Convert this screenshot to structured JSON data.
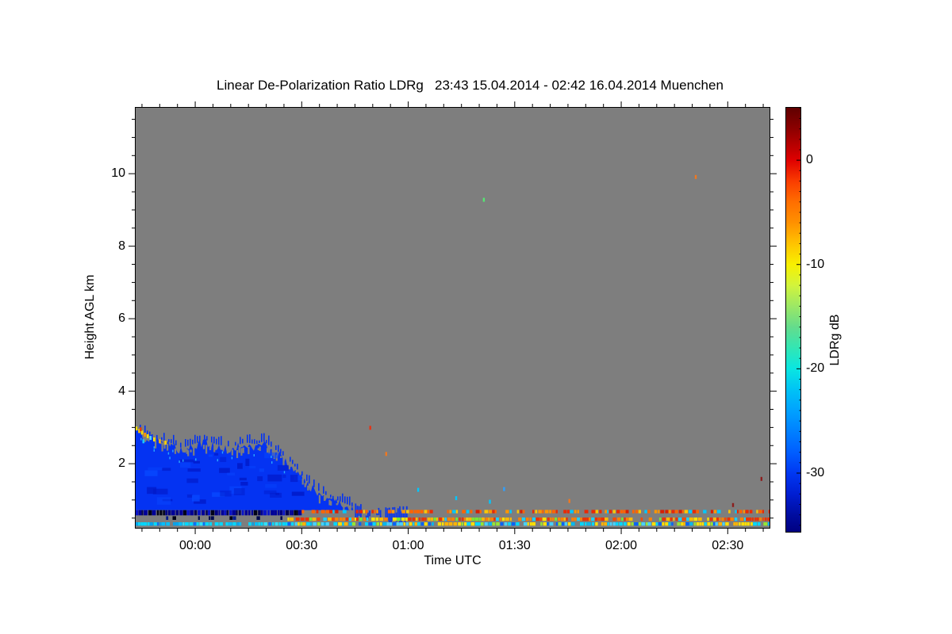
{
  "title": "Linear De-Polarization Ratio LDRg   23:43 15.04.2014 - 02:42 16.04.2014 Muenchen",
  "station": "Muenchen",
  "time_span": {
    "start": "23:43 15.04.2014",
    "end": "02:42 16.04.2014"
  },
  "axes": {
    "x": {
      "label": "Time UTC",
      "tick_labels": [
        "00:00",
        "00:30",
        "01:00",
        "01:30",
        "02:00",
        "02:30"
      ]
    },
    "y": {
      "label": "Height AGL km",
      "tick_labels": [
        "2",
        "4",
        "6",
        "8",
        "10"
      ]
    }
  },
  "colorbar": {
    "label": "LDRg dB",
    "tick_labels": [
      "0",
      "-10",
      "-20",
      "-30"
    ]
  },
  "chart_data": {
    "type": "heatmap",
    "title": "Linear De-Polarization Ratio LDRg   23:43 15.04.2014 - 02:42 16.04.2014 Muenchen",
    "xlabel": "Time UTC",
    "ylabel": "Height AGL km",
    "x_axis": {
      "start_utc": "23:43",
      "end_utc": "02:42",
      "minutes_total": 179,
      "major_ticks": [
        {
          "label": "00:00",
          "minute": 17
        },
        {
          "label": "00:30",
          "minute": 47
        },
        {
          "label": "01:00",
          "minute": 77
        },
        {
          "label": "01:30",
          "minute": 107
        },
        {
          "label": "02:00",
          "minute": 137
        },
        {
          "label": "02:30",
          "minute": 167
        }
      ],
      "minor_tick_step_minutes": 5,
      "first_minor_minute": 2
    },
    "y_axis": {
      "range_km": [
        0.21,
        11.84
      ],
      "major_ticks": [
        2,
        4,
        6,
        8,
        10
      ],
      "minor_step_km": 0.5
    },
    "background": {
      "color": "#7e7e7e",
      "meaning": "no signal / below detection"
    },
    "colorbar": {
      "label": "LDRg dB",
      "value_range": [
        -35.7,
        5.1
      ],
      "tick_values": [
        0,
        -10,
        -20,
        -30
      ],
      "minor_tick_step_db": 1,
      "stops": [
        [
          5.1,
          "#5e0000"
        ],
        [
          3,
          "#8d0000"
        ],
        [
          1,
          "#c30000"
        ],
        [
          0,
          "#e00000"
        ],
        [
          -2,
          "#fa3c00"
        ],
        [
          -4,
          "#ff6e00"
        ],
        [
          -6,
          "#ff9100"
        ],
        [
          -8,
          "#ffc300"
        ],
        [
          -10,
          "#f8f000"
        ],
        [
          -12,
          "#d2f43c"
        ],
        [
          -14,
          "#9ce865"
        ],
        [
          -16,
          "#64dc8c"
        ],
        [
          -18,
          "#32e6b4"
        ],
        [
          -20,
          "#0ae6e1"
        ],
        [
          -22,
          "#00c3f5"
        ],
        [
          -24,
          "#00a2ff"
        ],
        [
          -26,
          "#0080ff"
        ],
        [
          -28,
          "#005eff"
        ],
        [
          -30,
          "#0038f2"
        ],
        [
          -32,
          "#001ed2"
        ],
        [
          -34,
          "#000da0"
        ],
        [
          -35.7,
          "#000080"
        ]
      ]
    },
    "cloud_layer": {
      "meaning": "boundary-layer cloud/aerosol, LDRg ~ -28 to -32 dB (blue)",
      "color": "#0433f2",
      "base_km": 0.72,
      "top_profile_min_km": [
        [
          0,
          2.95
        ],
        [
          2,
          2.82
        ],
        [
          4,
          2.7
        ],
        [
          6,
          2.63
        ],
        [
          9,
          2.55
        ],
        [
          13,
          2.37
        ],
        [
          17,
          2.5
        ],
        [
          20,
          2.58
        ],
        [
          23,
          2.46
        ],
        [
          27,
          2.4
        ],
        [
          31,
          2.52
        ],
        [
          34,
          2.47
        ],
        [
          36,
          2.55
        ],
        [
          38,
          2.42
        ],
        [
          40,
          2.28
        ],
        [
          43,
          2.05
        ],
        [
          45,
          1.85
        ],
        [
          47,
          1.6
        ],
        [
          49,
          1.38
        ],
        [
          52,
          1.16
        ],
        [
          55,
          1.0
        ],
        [
          58,
          0.88
        ],
        [
          60,
          0.8
        ],
        [
          61.5,
          0.74
        ]
      ]
    },
    "wisps": [
      {
        "t0": 61.5,
        "t1": 64,
        "h_top": 0.95,
        "h_bot": 0.5
      },
      {
        "t0": 64.5,
        "t1": 66.5,
        "h_top": 0.75,
        "h_bot": 0.45
      },
      {
        "t0": 67.5,
        "t1": 70,
        "h_top": 0.8,
        "h_bot": 0.48
      },
      {
        "t0": 70.5,
        "t1": 76.5,
        "h_top": 0.85,
        "h_bot": 0.35
      }
    ],
    "surface_stripes": [
      {
        "name": "ground-navy-left",
        "t0": 0,
        "t1": 47,
        "h_top": 0.72,
        "h_bot": 0.575,
        "gap": 0.04,
        "palette": [
          "#000098",
          "#000050",
          "#000318",
          "#0a14c8",
          "#000098",
          "#000080"
        ]
      },
      {
        "name": "sparse-dark-left",
        "t0": 0,
        "t1": 43,
        "h_top": 0.55,
        "h_bot": 0.45,
        "gap": 0.8,
        "palette": [
          "#000a50",
          "#041a8c",
          "#000318"
        ]
      },
      {
        "name": "rain-top-orange",
        "t0": 47,
        "t1": 179,
        "h_top": 0.725,
        "h_bot": 0.63,
        "gap": 0.32,
        "palette": [
          "#ff6400",
          "#eb2800",
          "#ff9600",
          "#d71e00",
          "#ffc800",
          "#ff6400",
          "#eb2800",
          "#00c8ff"
        ]
      },
      {
        "name": "rain-mid-red",
        "t0": 43,
        "t1": 179,
        "h_top": 0.515,
        "h_bot": 0.42,
        "gap": 0.1,
        "palette": [
          "#eb3200",
          "#ff8200",
          "#ffb900",
          "#ffe300",
          "#f54a00",
          "#eb3200",
          "#19d2ff",
          "#78e632",
          "#ff8200"
        ]
      },
      {
        "name": "near-ground-cyan-left",
        "t0": 0,
        "t1": 43,
        "h_top": 0.385,
        "h_bot": 0.29,
        "gap": 0.13,
        "palette": [
          "#00d7ff",
          "#00beff",
          "#2ee1ff",
          "#00a5f0",
          "#0073ff",
          "#00d7ff"
        ]
      },
      {
        "name": "near-ground-multi-right",
        "t0": 43,
        "t1": 179,
        "h_top": 0.385,
        "h_bot": 0.29,
        "gap": 0.1,
        "palette": [
          "#ffe000",
          "#00d7ff",
          "#46d2ff",
          "#96e632",
          "#0064ff",
          "#ffb400",
          "#00b9f0",
          "#ffe000",
          "#00d7ff"
        ]
      }
    ],
    "cloud_edge_specks": [
      {
        "t": 0.4,
        "h": 2.97,
        "c": "#ffe000"
      },
      {
        "t": 1.2,
        "h": 2.9,
        "c": "#ffc800"
      },
      {
        "t": 2.0,
        "h": 2.86,
        "c": "#ffe000"
      },
      {
        "t": 2.8,
        "h": 2.8,
        "c": "#ff9600"
      },
      {
        "t": 3.6,
        "h": 2.76,
        "c": "#ffe000"
      },
      {
        "t": 4.4,
        "h": 2.71,
        "c": "#50d2ff"
      },
      {
        "t": 5.4,
        "h": 2.67,
        "c": "#ffe000"
      },
      {
        "t": 7.0,
        "h": 2.62,
        "c": "#ffb400"
      },
      {
        "t": 2.4,
        "h": 2.62,
        "c": "#19c8ff"
      },
      {
        "t": 8.6,
        "h": 2.58,
        "c": "#ffd200"
      },
      {
        "t": 1.6,
        "h": 2.95,
        "c": "#eb3c00"
      }
    ],
    "isolated_specks": [
      {
        "t": 98.3,
        "h": 9.28,
        "c": "#55e673"
      },
      {
        "t": 158,
        "h": 9.91,
        "c": "#f07820"
      },
      {
        "t": 176.5,
        "h": 1.58,
        "c": "#8c1e1e"
      },
      {
        "t": 168.5,
        "h": 0.86,
        "c": "#8c1e1e"
      },
      {
        "t": 79.8,
        "h": 1.28,
        "c": "#00c8ff"
      },
      {
        "t": 66.3,
        "h": 2.99,
        "c": "#e63214"
      },
      {
        "t": 70.8,
        "h": 2.27,
        "c": "#f07820"
      },
      {
        "t": 122.4,
        "h": 0.97,
        "c": "#f07820"
      },
      {
        "t": 100,
        "h": 0.95,
        "c": "#00c8ff"
      },
      {
        "t": 90.5,
        "h": 1.05,
        "c": "#00c8ff"
      },
      {
        "t": 104,
        "h": 1.3,
        "c": "#2ea0ff"
      }
    ]
  }
}
